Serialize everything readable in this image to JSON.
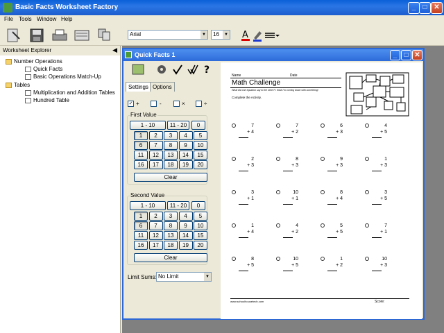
{
  "app": {
    "title": "Basic Facts Worksheet Factory"
  },
  "menu": [
    "File",
    "Tools",
    "Window",
    "Help"
  ],
  "toolbar": {
    "font": "Arial",
    "size": "16"
  },
  "explorer": {
    "title": "Worksheet Explorer",
    "items": [
      {
        "label": "Number Operations",
        "type": "folder"
      },
      {
        "label": "Quick Facts",
        "type": "doc"
      },
      {
        "label": "Basic Operations Match-Up",
        "type": "doc"
      },
      {
        "label": "Tables",
        "type": "folder"
      },
      {
        "label": "Multiplication and Addition Tables",
        "type": "doc"
      },
      {
        "label": "Hundred Table",
        "type": "doc"
      }
    ]
  },
  "child": {
    "title": "Quick Facts 1"
  },
  "settings": {
    "tabs": [
      "Settings",
      "Options"
    ],
    "ops": [
      "+",
      "-",
      "×",
      "÷"
    ],
    "ops_checked": [
      true,
      false,
      false,
      false
    ],
    "first_label": "First Value",
    "second_label": "Second Value",
    "range_buttons": [
      "1 - 10",
      "11 - 20",
      "0"
    ],
    "clear": "Clear",
    "limit_label": "Limit Sums:",
    "limit_value": "No Limit",
    "numbers": [
      "1",
      "2",
      "3",
      "4",
      "5",
      "6",
      "7",
      "8",
      "9",
      "10",
      "11",
      "12",
      "13",
      "14",
      "15",
      "16",
      "17",
      "18",
      "19",
      "20"
    ]
  },
  "worksheet": {
    "name_label": "Name",
    "date_label": "Date",
    "title": "Math Challenge",
    "subtitle": "What did one equation say to the other? I think I'm coming down with something!",
    "instruction": "Complete the Activity.",
    "footer_url": "www.schoolhousetech.com",
    "score_label": "Score:",
    "problems": [
      [
        "7",
        "+ 4"
      ],
      [
        "7",
        "+ 2"
      ],
      [
        "6",
        "+ 3"
      ],
      [
        "4",
        "+ 5"
      ],
      [
        "2",
        "+ 3"
      ],
      [
        "8",
        "+ 3"
      ],
      [
        "9",
        "+ 3"
      ],
      [
        "1",
        "+ 3"
      ],
      [
        "3",
        "+ 1"
      ],
      [
        "10",
        "+ 1"
      ],
      [
        "8",
        "+ 4"
      ],
      [
        "3",
        "+ 5"
      ],
      [
        "1",
        "+ 4"
      ],
      [
        "4",
        "+ 2"
      ],
      [
        "5",
        "+ 5"
      ],
      [
        "7",
        "+ 1"
      ],
      [
        "8",
        "+ 5"
      ],
      [
        "10",
        "+ 5"
      ],
      [
        "1",
        "+ 2"
      ],
      [
        "10",
        "+ 3"
      ]
    ]
  }
}
